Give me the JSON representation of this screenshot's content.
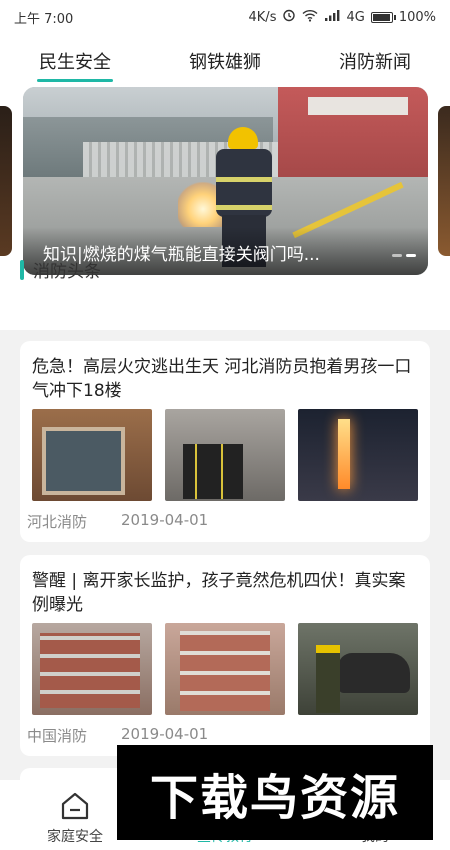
{
  "status_bar": {
    "time": "上午 7:00",
    "speed": "4K/s",
    "network": "4G",
    "battery": "100%",
    "battery_level": 1.0
  },
  "tabs": [
    {
      "label": "民生安全",
      "active": true
    },
    {
      "label": "钢铁雄狮",
      "active": false
    },
    {
      "label": "消防新闻",
      "active": false
    }
  ],
  "banner": {
    "caption": "知识|燃烧的煤气瓶能直接关阀门吗...",
    "page_count": 2,
    "current_page": 2
  },
  "section": {
    "title": "消防头条"
  },
  "articles": [
    {
      "title": "危急！高层火灾逃出生天 河北消防员抱着男孩一口气冲下18楼",
      "source": "河北消防",
      "date": "2019-04-01"
    },
    {
      "title": "警醒 | 离开家长监护，孩子竟然危机四伏！真实案例曝光",
      "source": "中国消防",
      "date": "2019-04-01"
    }
  ],
  "bottom_nav": [
    {
      "label": "家庭安全",
      "icon": "home-icon",
      "active": false
    },
    {
      "label": "宣传教育",
      "icon": "education-icon",
      "active": true
    },
    {
      "label": "我的",
      "icon": "profile-icon",
      "active": false
    }
  ],
  "watermark": {
    "text": "下载鸟资源"
  },
  "colors": {
    "accent": "#1fb8a6"
  }
}
